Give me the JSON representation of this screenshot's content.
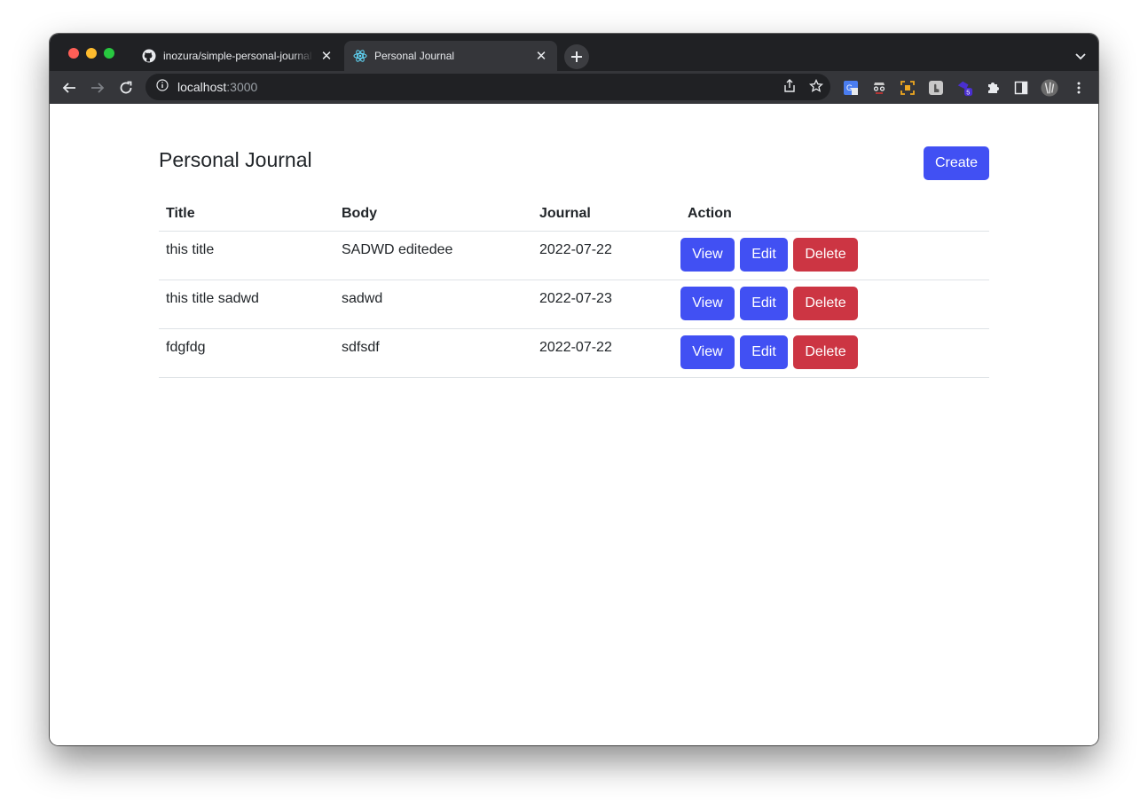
{
  "browser": {
    "tabs": [
      {
        "title": "inozura/simple-personal-journal",
        "favicon": "github-icon",
        "active": false
      },
      {
        "title": "Personal Journal",
        "favicon": "react-icon",
        "active": true
      }
    ],
    "address": {
      "host": "localhost",
      "port": ":3000"
    }
  },
  "page": {
    "title": "Personal Journal",
    "create_label": "Create",
    "columns": [
      "Title",
      "Body",
      "Journal",
      "Action"
    ],
    "rows": [
      {
        "title": "this title",
        "body": "SADWD editedee",
        "journal": "2022-07-22"
      },
      {
        "title": "this title sadwd",
        "body": "sadwd",
        "journal": "2022-07-23"
      },
      {
        "title": "fdgfdg",
        "body": "sdfsdf",
        "journal": "2022-07-22"
      }
    ],
    "actions": {
      "view": "View",
      "edit": "Edit",
      "delete": "Delete"
    }
  },
  "colors": {
    "primary": "#4150f3",
    "danger": "#cc3543",
    "chrome_dark": "#202124",
    "chrome_toolbar": "#35363a"
  }
}
